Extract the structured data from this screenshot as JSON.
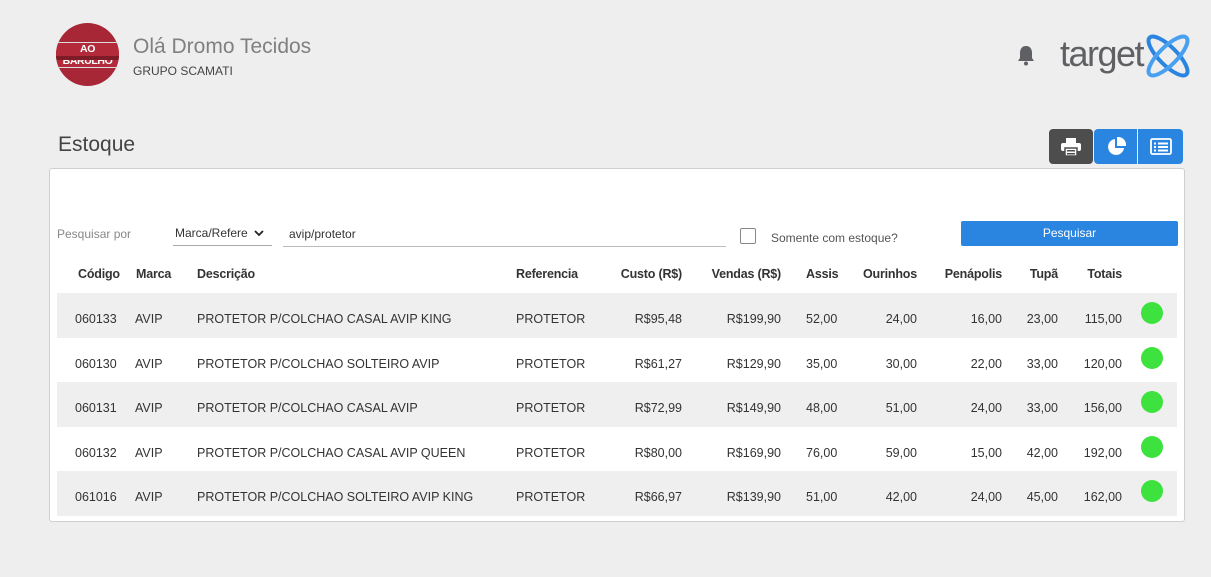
{
  "header": {
    "logo_text": "AO BARULHO",
    "greeting": "Olá Dromo Tecidos",
    "group": "GRUPO SCAMATI",
    "brand": "target"
  },
  "page": {
    "title": "Estoque"
  },
  "toolbar": {
    "icons": [
      "print-icon",
      "pie-chart-icon",
      "list-icon"
    ]
  },
  "search": {
    "label": "Pesquisar por",
    "field_selected": "Marca/Refere",
    "query": "avip/protetor",
    "stock_only_label": "Somente com estoque?",
    "stock_only_checked": false,
    "button_label": "Pesquisar"
  },
  "table": {
    "headers": {
      "codigo": "Código",
      "marca": "Marca",
      "descricao": "Descrição",
      "referencia": "Referencia",
      "custo": "Custo (R$)",
      "vendas": "Vendas (R$)",
      "assis": "Assis",
      "ourinhos": "Ourinhos",
      "penapolis": "Penápolis",
      "tupa": "Tupã",
      "totais": "Totais"
    },
    "rows": [
      {
        "codigo": "060133",
        "marca": "AVIP",
        "descricao": "PROTETOR P/COLCHAO CASAL AVIP KING",
        "referencia": "PROTETOR",
        "custo": "R$95,48",
        "vendas": "R$199,90",
        "assis": "52,00",
        "ourinhos": "24,00",
        "penapolis": "16,00",
        "tupa": "23,00",
        "totais": "115,00",
        "status_color": "#3ee23e"
      },
      {
        "codigo": "060130",
        "marca": "AVIP",
        "descricao": "PROTETOR P/COLCHAO SOLTEIRO AVIP",
        "referencia": "PROTETOR",
        "custo": "R$61,27",
        "vendas": "R$129,90",
        "assis": "35,00",
        "ourinhos": "30,00",
        "penapolis": "22,00",
        "tupa": "33,00",
        "totais": "120,00",
        "status_color": "#3ee23e"
      },
      {
        "codigo": "060131",
        "marca": "AVIP",
        "descricao": "PROTETOR P/COLCHAO CASAL AVIP",
        "referencia": "PROTETOR",
        "custo": "R$72,99",
        "vendas": "R$149,90",
        "assis": "48,00",
        "ourinhos": "51,00",
        "penapolis": "24,00",
        "tupa": "33,00",
        "totais": "156,00",
        "status_color": "#3ee23e"
      },
      {
        "codigo": "060132",
        "marca": "AVIP",
        "descricao": "PROTETOR P/COLCHAO CASAL AVIP QUEEN",
        "referencia": "PROTETOR",
        "custo": "R$80,00",
        "vendas": "R$169,90",
        "assis": "76,00",
        "ourinhos": "59,00",
        "penapolis": "15,00",
        "tupa": "42,00",
        "totais": "192,00",
        "status_color": "#3ee23e"
      },
      {
        "codigo": "061016",
        "marca": "AVIP",
        "descricao": "PROTETOR P/COLCHAO SOLTEIRO AVIP KING",
        "referencia": "PROTETOR",
        "custo": "R$66,97",
        "vendas": "R$139,90",
        "assis": "51,00",
        "ourinhos": "42,00",
        "penapolis": "24,00",
        "tupa": "45,00",
        "totais": "162,00",
        "status_color": "#3ee23e"
      }
    ]
  },
  "colors": {
    "accent": "#2a85e0",
    "dark_button": "#4d4d4d",
    "status_ok": "#3ee23e",
    "logo_red": "#a82737"
  }
}
